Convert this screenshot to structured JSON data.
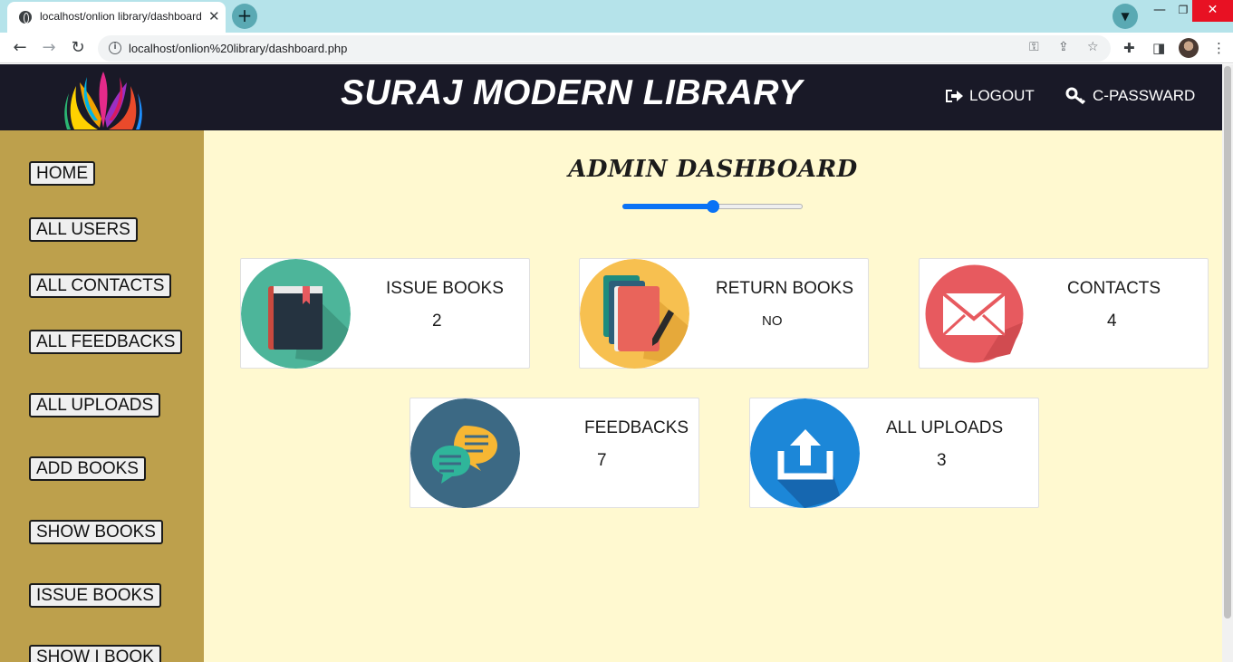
{
  "browser": {
    "tab_title": "localhost/onlion library/dashboard.php",
    "tab_close": "✕",
    "new_tab": "+",
    "url": "localhost/onlion%20library/dashboard.php",
    "window_controls": {
      "minimize": "—",
      "maximize": "❐",
      "close": "✕"
    }
  },
  "header": {
    "title": "SURAJ MODERN LIBRARY",
    "logout_label": "LOGOUT",
    "cpassword_label": "C-PASSWARD",
    "logout_icon": "sign-out-icon",
    "cpassword_icon": "key-icon"
  },
  "sidebar": {
    "items": [
      {
        "label": "HOME"
      },
      {
        "label": "ALL USERS"
      },
      {
        "label": "ALL CONTACTS"
      },
      {
        "label": "ALL FEEDBACKS"
      },
      {
        "label": "ALL UPLOADS"
      },
      {
        "label": "ADD BOOKS"
      },
      {
        "label": "SHOW BOOKS"
      },
      {
        "label": "ISSUE BOOKS"
      },
      {
        "label": "SHOW I BOOK"
      }
    ]
  },
  "main": {
    "title": "ADMIN DASHBOARD",
    "slider_value": 0.5,
    "cards": [
      {
        "label": "ISSUE BOOKS",
        "value": "2",
        "icon": "book-icon",
        "color": "#4db59a"
      },
      {
        "label": "RETURN BOOKS",
        "value": "NO",
        "icon": "books-pencil-icon",
        "color": "#f7c050"
      },
      {
        "label": "CONTACTS",
        "value": "4",
        "icon": "envelope-icon",
        "color": "#e75a5f"
      },
      {
        "label": "FEEDBACKS",
        "value": "7",
        "icon": "chat-bubbles-icon",
        "color": "#3c6984"
      },
      {
        "label": "ALL UPLOADS",
        "value": "3",
        "icon": "upload-icon",
        "color": "#1c87d8"
      }
    ]
  },
  "colors": {
    "header_bg": "#191927",
    "sidebar_bg": "#bda04c",
    "main_bg": "#fff9d0",
    "accent": "#0a73f5"
  }
}
